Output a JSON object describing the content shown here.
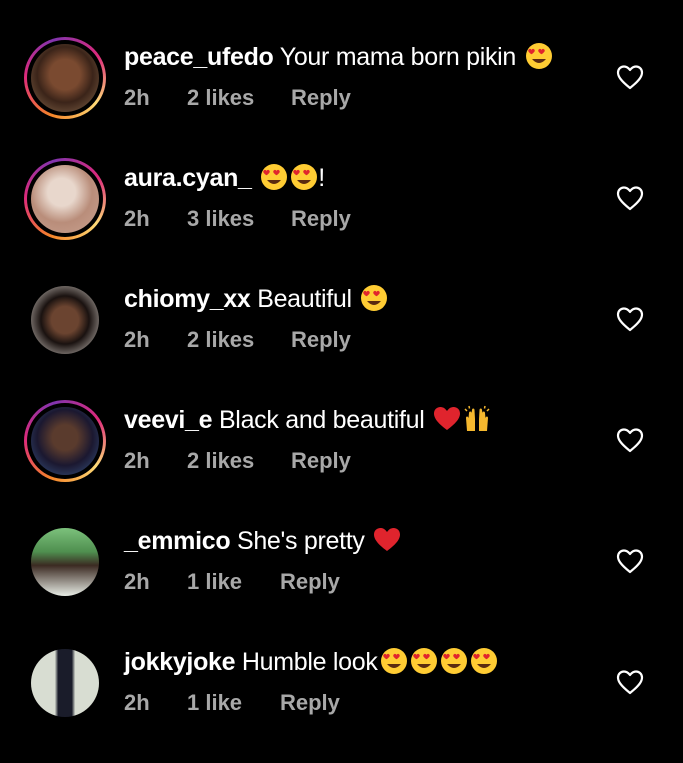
{
  "comments": [
    {
      "username": "peace_ufedo",
      "text": "Your mama born pikin",
      "emojis": [
        "heart-eyes"
      ],
      "time": "2h",
      "likes": "2 likes",
      "reply": "Reply",
      "story_ring": true,
      "avatar_color": "#5a3a28"
    },
    {
      "username": "aura.cyan_",
      "text": "",
      "emojis": [
        "heart-eyes",
        "heart-eyes"
      ],
      "suffix": "!",
      "time": "2h",
      "likes": "3 likes",
      "reply": "Reply",
      "story_ring": true,
      "avatar_color": "#c9a48f"
    },
    {
      "username": "chiomy_xx",
      "text": "Beautiful",
      "emojis": [
        "heart-eyes"
      ],
      "time": "2h",
      "likes": "2 likes",
      "reply": "Reply",
      "story_ring": false,
      "avatar_color": "#2a1d18"
    },
    {
      "username": "veevi_e",
      "text": "Black and beautiful",
      "emojis": [
        "red-heart",
        "raised-hands"
      ],
      "time": "2h",
      "likes": "2 likes",
      "reply": "Reply",
      "story_ring": true,
      "avatar_color": "#1c1a2e"
    },
    {
      "username": "_emmico",
      "text": "She's pretty",
      "emojis": [
        "red-heart"
      ],
      "time": "2h",
      "likes": "1 like",
      "reply": "Reply",
      "story_ring": false,
      "avatar_color": "#6aa56a"
    },
    {
      "username": "jokkyjoke",
      "text": "Humble look",
      "emojis": [
        "heart-eyes",
        "heart-eyes",
        "heart-eyes",
        "heart-eyes"
      ],
      "time": "2h",
      "likes": "1 like",
      "reply": "Reply",
      "story_ring": false,
      "avatar_color": "#cfd4c8"
    }
  ],
  "icons": {
    "like_button": "heart-outline-icon"
  },
  "colors": {
    "background": "#000000",
    "meta_text": "#a8a8a8",
    "heart": "#e0242d",
    "story_ring_start": "#f58529",
    "story_ring_end": "#dd2a7b"
  }
}
